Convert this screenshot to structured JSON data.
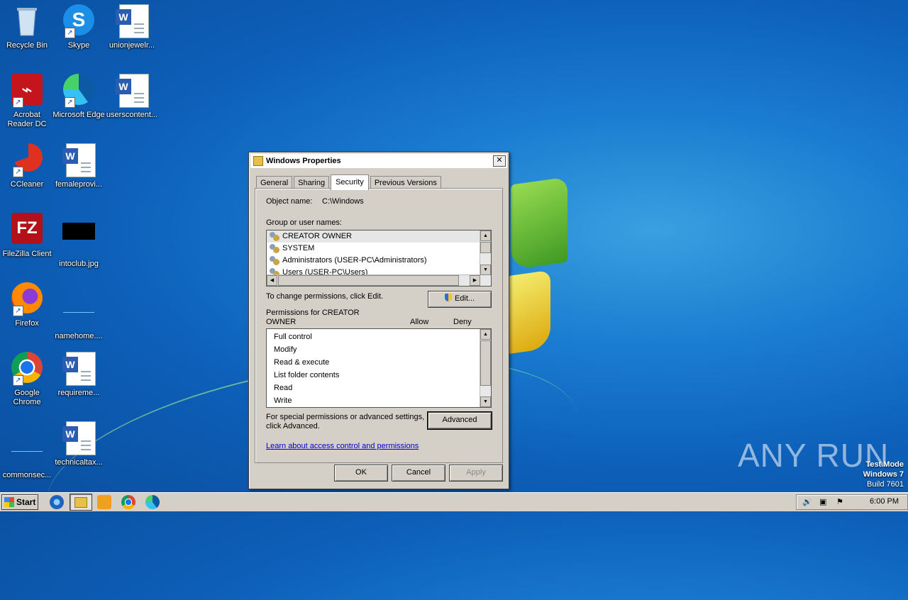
{
  "desktop": {
    "icons": [
      {
        "label": "Recycle Bin"
      },
      {
        "label": "Skype"
      },
      {
        "label": "unionjewelr..."
      },
      {
        "label": "Acrobat Reader DC"
      },
      {
        "label": "Microsoft Edge"
      },
      {
        "label": "userscontent..."
      },
      {
        "label": "CCleaner"
      },
      {
        "label": "femaleprovi..."
      },
      {
        "label": "FileZilla Client"
      },
      {
        "label": "intoclub.jpg"
      },
      {
        "label": "Firefox"
      },
      {
        "label": "namehome...."
      },
      {
        "label": "Google Chrome"
      },
      {
        "label": "requireme..."
      },
      {
        "label": "commonsec..."
      },
      {
        "label": "technicaltax..."
      }
    ]
  },
  "dialog": {
    "title": "Windows Properties",
    "tabs": [
      "General",
      "Sharing",
      "Security",
      "Previous Versions"
    ],
    "active_tab": "Security",
    "object_name_label": "Object name:",
    "object_name_value": "C:\\Windows",
    "group_label": "Group or user names:",
    "groups": [
      "CREATOR OWNER",
      "SYSTEM",
      "Administrators (USER-PC\\Administrators)",
      "Users (USER-PC\\Users)"
    ],
    "change_text": "To change permissions, click Edit.",
    "edit_button": "Edit...",
    "permissions_for_line1": "Permissions for CREATOR",
    "permissions_for_line2": "OWNER",
    "allow_header": "Allow",
    "deny_header": "Deny",
    "permissions": [
      "Full control",
      "Modify",
      "Read & execute",
      "List folder contents",
      "Read",
      "Write"
    ],
    "special_line1": "For special permissions or advanced settings,",
    "special_line2": "click Advanced.",
    "advanced_button": "Advanced",
    "learn_link": "Learn about access control and permissions",
    "ok_button": "OK",
    "cancel_button": "Cancel",
    "apply_button": "Apply"
  },
  "watermark": {
    "brand": "ANY RUN",
    "line1": "Test Mode",
    "line2": "Windows 7",
    "line3": "Build 7601"
  },
  "taskbar": {
    "start_label": "Start",
    "clock": "6:00 PM"
  }
}
